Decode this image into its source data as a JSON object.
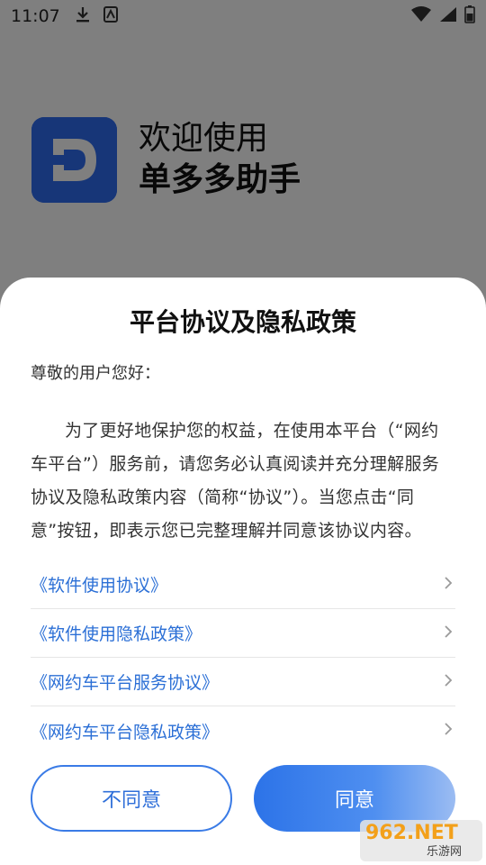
{
  "status_bar": {
    "time": "11:07",
    "left_icons": [
      "download-icon",
      "notification-icon"
    ],
    "right_icons": [
      "wifi-icon",
      "signal-icon",
      "battery-icon"
    ]
  },
  "welcome": {
    "logo_letter": "D",
    "line1": "欢迎使用",
    "line2": "单多多助手"
  },
  "dialog": {
    "title": "平台协议及隐私政策",
    "greeting": "尊敬的用户您好：",
    "body": "为了更好地保护您的权益，在使用本平台（“网约车平台”）服务前，请您务必认真阅读并充分理解服务协议及隐私政策内容（简称“协议”）。当您点击“同意”按钮，即表示您已完整理解并同意该协议内容。",
    "links": [
      {
        "label": "《软件使用协议》"
      },
      {
        "label": "《软件使用隐私政策》"
      },
      {
        "label": "《网约车平台服务协议》"
      },
      {
        "label": "《网约车平台隐私政策》"
      }
    ],
    "disagree_label": "不同意",
    "agree_label": "同意"
  },
  "watermark": {
    "number": "962.NET",
    "subtitle": "乐游网"
  },
  "colors": {
    "accent": "#2f6fd9",
    "link": "#2b6fd6",
    "logo_bg": "#2f6df0"
  }
}
